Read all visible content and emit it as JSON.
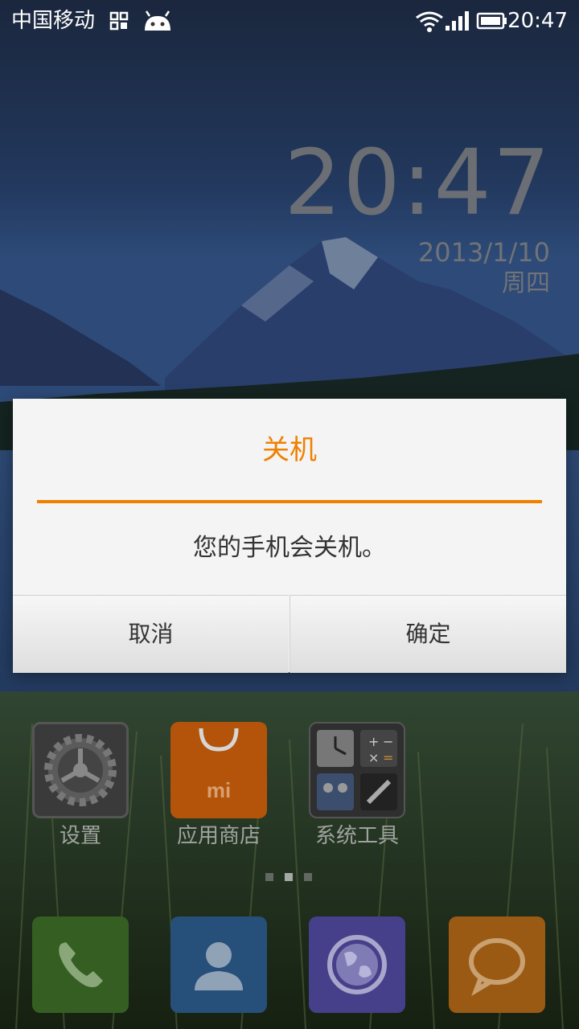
{
  "status_bar": {
    "carrier": "中国移动",
    "time": "20:47",
    "icons": [
      "qr-code-icon",
      "android-icon",
      "wifi-icon",
      "signal-icon",
      "battery-icon"
    ]
  },
  "clock_widget": {
    "time": "20:47",
    "date": "2013/1/10",
    "weekday": "周四"
  },
  "dialog": {
    "title": "关机",
    "message": "您的手机会关机。",
    "cancel_label": "取消",
    "ok_label": "确定",
    "accent_color": "#f08000"
  },
  "home_apps": [
    {
      "label": "设置",
      "icon": "settings-gear-icon"
    },
    {
      "label": "应用商店",
      "icon": "app-store-bag-icon"
    },
    {
      "label": "系统工具",
      "icon": "system-tools-folder-icon"
    }
  ],
  "page_indicator": {
    "pages": 3,
    "current": 2
  },
  "dock": [
    {
      "icon": "phone-icon"
    },
    {
      "icon": "contacts-icon"
    },
    {
      "icon": "browser-globe-icon"
    },
    {
      "icon": "messages-icon"
    }
  ]
}
